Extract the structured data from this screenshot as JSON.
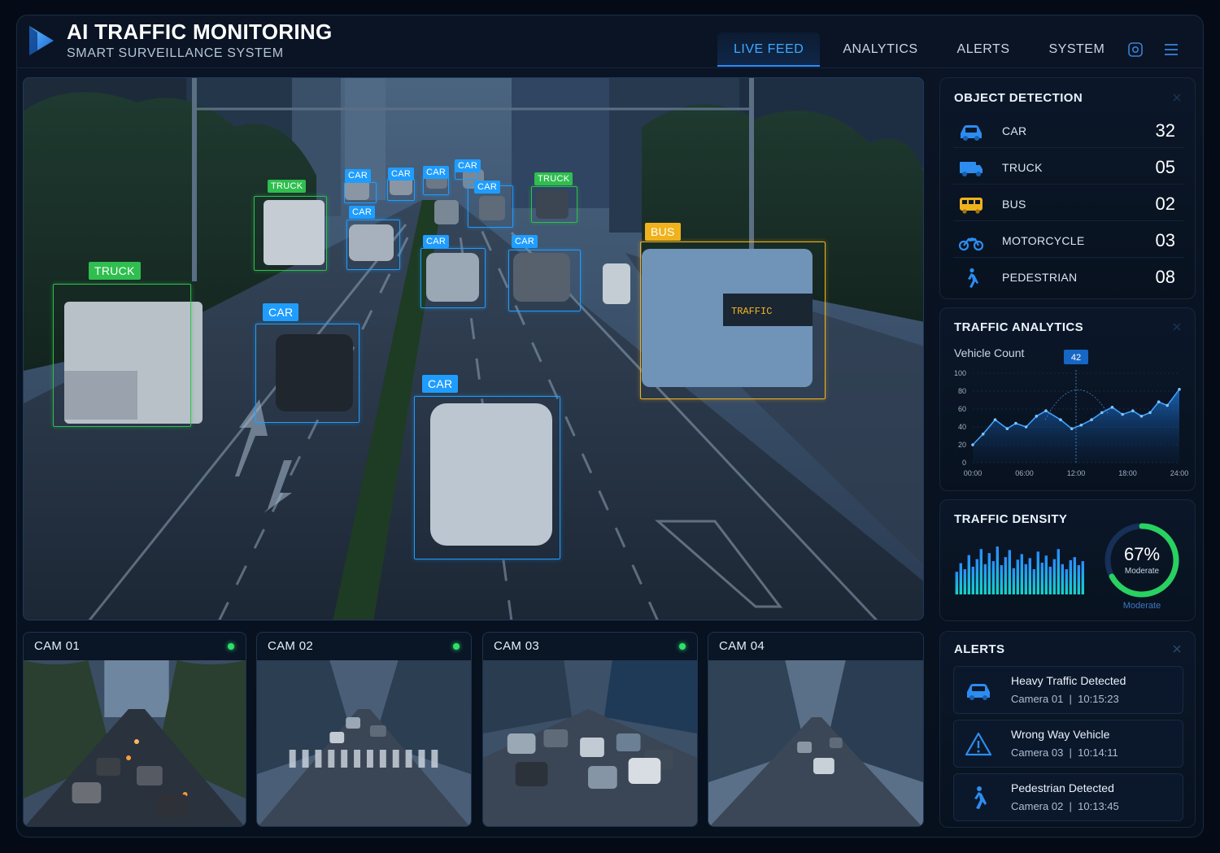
{
  "app": {
    "title": "AI TRAFFIC MONITORING",
    "subtitle": "SMART SURVEILLANCE SYSTEM"
  },
  "nav": {
    "tabs": [
      {
        "label": "LIVE FEED",
        "active": true
      },
      {
        "label": "ANALYTICS",
        "active": false
      },
      {
        "label": "ALERTS",
        "active": false
      },
      {
        "label": "SYSTEM",
        "active": false
      }
    ],
    "icons": [
      "settings-icon",
      "menu-icon"
    ]
  },
  "main_feed": {
    "detections": [
      {
        "label": "TRUCK",
        "class": "truck"
      },
      {
        "label": "TRUCK",
        "class": "truck"
      },
      {
        "label": "TRUCK",
        "class": "truck"
      },
      {
        "label": "CAR",
        "class": "car"
      },
      {
        "label": "CAR",
        "class": "car"
      },
      {
        "label": "CAR",
        "class": "car"
      },
      {
        "label": "CAR",
        "class": "car"
      },
      {
        "label": "CAR",
        "class": "car"
      },
      {
        "label": "CAR",
        "class": "car"
      },
      {
        "label": "CAR",
        "class": "car"
      },
      {
        "label": "CAR",
        "class": "car"
      },
      {
        "label": "CAR",
        "class": "car"
      },
      {
        "label": "CAR",
        "class": "car"
      },
      {
        "label": "BUS",
        "class": "bus"
      }
    ],
    "bus_destination_sign": "TRAFFIC"
  },
  "cameras": [
    {
      "title": "CAM 01",
      "online": true
    },
    {
      "title": "CAM 02",
      "online": true
    },
    {
      "title": "CAM 03",
      "online": true
    },
    {
      "title": "CAM 04",
      "online": false
    }
  ],
  "object_detection": {
    "title": "OBJECT DETECTION",
    "rows": [
      {
        "label": "CAR",
        "count": "32",
        "icon": "car-icon"
      },
      {
        "label": "TRUCK",
        "count": "05",
        "icon": "truck-icon"
      },
      {
        "label": "BUS",
        "count": "02",
        "icon": "bus-icon"
      },
      {
        "label": "MOTORCYCLE",
        "count": "03",
        "icon": "motorcycle-icon"
      },
      {
        "label": "PEDESTRIAN",
        "count": "08",
        "icon": "pedestrian-icon"
      }
    ]
  },
  "traffic_analytics": {
    "title": "TRAFFIC ANALYTICS",
    "subtitle": "Vehicle Count",
    "marker_label": "42"
  },
  "traffic_density": {
    "title": "TRAFFIC DENSITY",
    "percent": "67%",
    "value": 0.67,
    "inner_label": "Moderate",
    "outer_label": "Moderate",
    "bar_levels": [
      0.45,
      0.62,
      0.5,
      0.78,
      0.55,
      0.7,
      0.9,
      0.6,
      0.82,
      0.66,
      0.95,
      0.58,
      0.74,
      0.88,
      0.52,
      0.69,
      0.8,
      0.6,
      0.72,
      0.5,
      0.85,
      0.63,
      0.77,
      0.55,
      0.7,
      0.9,
      0.6,
      0.5,
      0.68,
      0.74,
      0.58,
      0.66
    ]
  },
  "alerts": {
    "title": "ALERTS",
    "items": [
      {
        "title": "Heavy Traffic Detected",
        "camera": "Camera 01",
        "time": "10:15:23",
        "icon": "car-icon"
      },
      {
        "title": "Wrong Way Vehicle",
        "camera": "Camera 03",
        "time": "10:14:11",
        "icon": "warning-icon"
      },
      {
        "title": "Pedestrian Detected",
        "camera": "Camera 02",
        "time": "10:13:45",
        "icon": "pedestrian-icon"
      }
    ]
  },
  "colors": {
    "accent": "#2f8cff",
    "truck": "#2fbe4f",
    "car": "#1f9dff",
    "bus": "#f0b21c",
    "online": "#2ee06a",
    "density": "#28d160"
  },
  "chart_data": {
    "type": "area",
    "title": "TRAFFIC ANALYTICS",
    "ylabel": "Vehicle Count",
    "xlabel": "",
    "x_ticks": [
      "00:00",
      "06:00",
      "12:00",
      "18:00",
      "24:00"
    ],
    "y_ticks": [
      0,
      20,
      40,
      60,
      80,
      100
    ],
    "ylim": [
      0,
      100
    ],
    "xlim": [
      0,
      24
    ],
    "series": [
      {
        "x": [
          0,
          1.2,
          2.6,
          4,
          5,
          6.2,
          7.4,
          8.5,
          10.2,
          11.5,
          12.6,
          13.8,
          15,
          16.2,
          17.4,
          18.6,
          19.6,
          20.6,
          21.6,
          22.6,
          24
        ],
        "values": [
          20,
          32,
          48,
          38,
          44,
          40,
          52,
          58,
          48,
          38,
          42,
          48,
          56,
          62,
          54,
          58,
          52,
          56,
          68,
          64,
          82
        ]
      }
    ],
    "annotations": [
      {
        "x": 12,
        "label": "42"
      }
    ]
  }
}
